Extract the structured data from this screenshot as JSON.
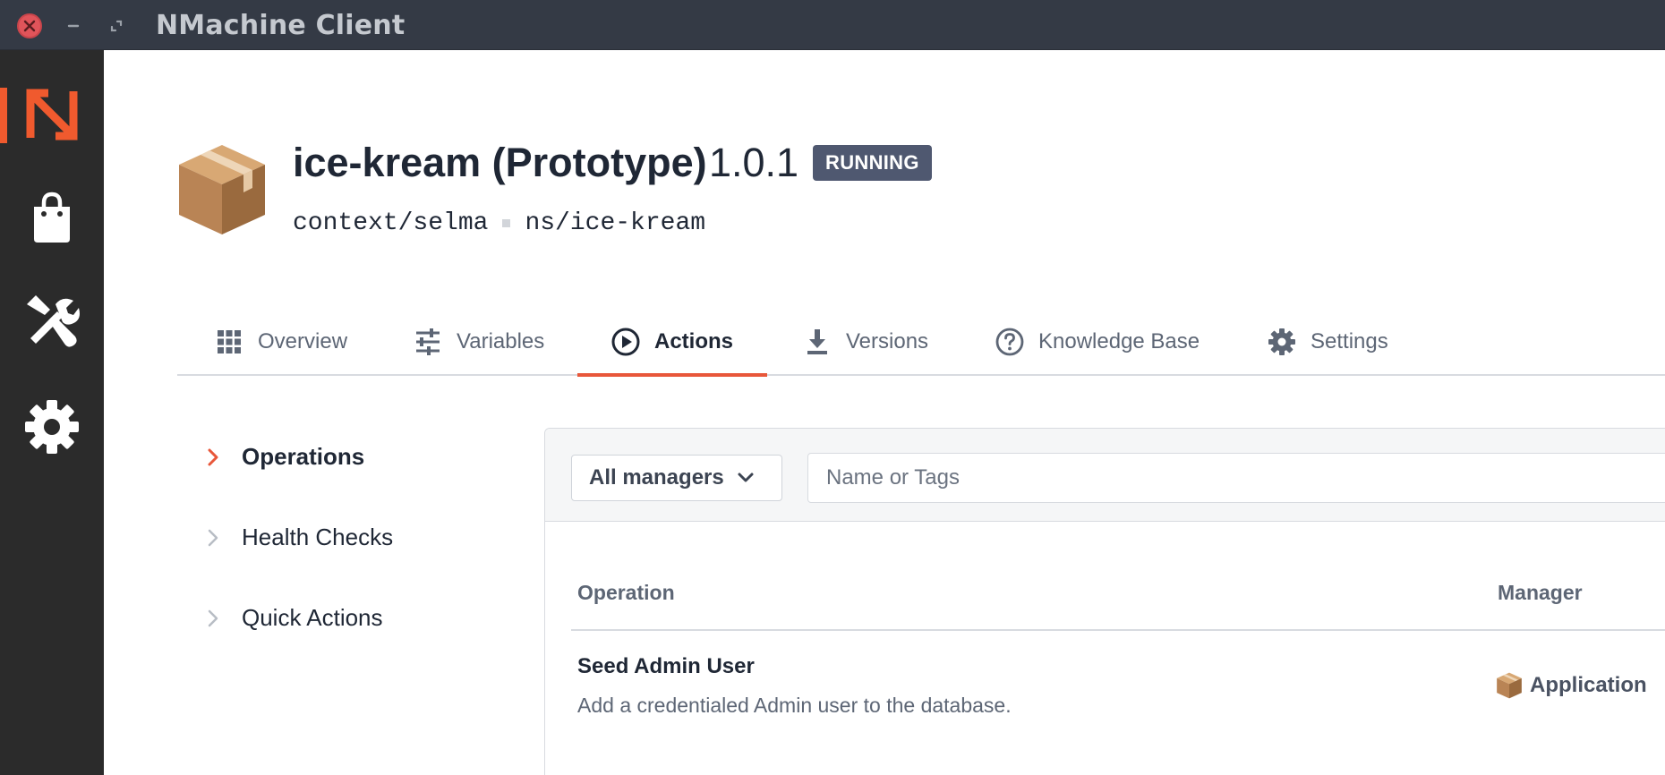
{
  "window": {
    "title": "NMachine Client"
  },
  "sidebar": {
    "items": [
      {
        "icon": "nmachine-logo-icon",
        "active": true
      },
      {
        "icon": "shopping-bag-icon",
        "active": false
      },
      {
        "icon": "tools-icon",
        "active": false
      },
      {
        "icon": "gear-icon",
        "active": false
      }
    ],
    "accent": "#f05a2e"
  },
  "header": {
    "icon": "package-box-icon",
    "title": "ice-kream (Prototype)",
    "version": "1.0.1",
    "status": "RUNNING",
    "context": "context/selma",
    "namespace": "ns/ice-kream"
  },
  "tabs": [
    {
      "label": "Overview",
      "icon": "grid-icon"
    },
    {
      "label": "Variables",
      "icon": "sliders-icon"
    },
    {
      "label": "Actions",
      "icon": "play-circle-icon",
      "active": true
    },
    {
      "label": "Versions",
      "icon": "download-icon"
    },
    {
      "label": "Knowledge Base",
      "icon": "help-circle-icon"
    },
    {
      "label": "Settings",
      "icon": "gear-icon"
    }
  ],
  "subnav": [
    {
      "label": "Operations",
      "active": true
    },
    {
      "label": "Health Checks",
      "active": false
    },
    {
      "label": "Quick Actions",
      "active": false
    }
  ],
  "filter": {
    "manager_select": "All managers",
    "search_placeholder": "Name or Tags"
  },
  "table": {
    "headers": {
      "operation": "Operation",
      "manager": "Manager"
    },
    "rows": [
      {
        "name": "Seed Admin User",
        "description": "Add a credentialed Admin user to the database.",
        "manager": "Application",
        "manager_icon": "package-box-icon"
      }
    ]
  }
}
